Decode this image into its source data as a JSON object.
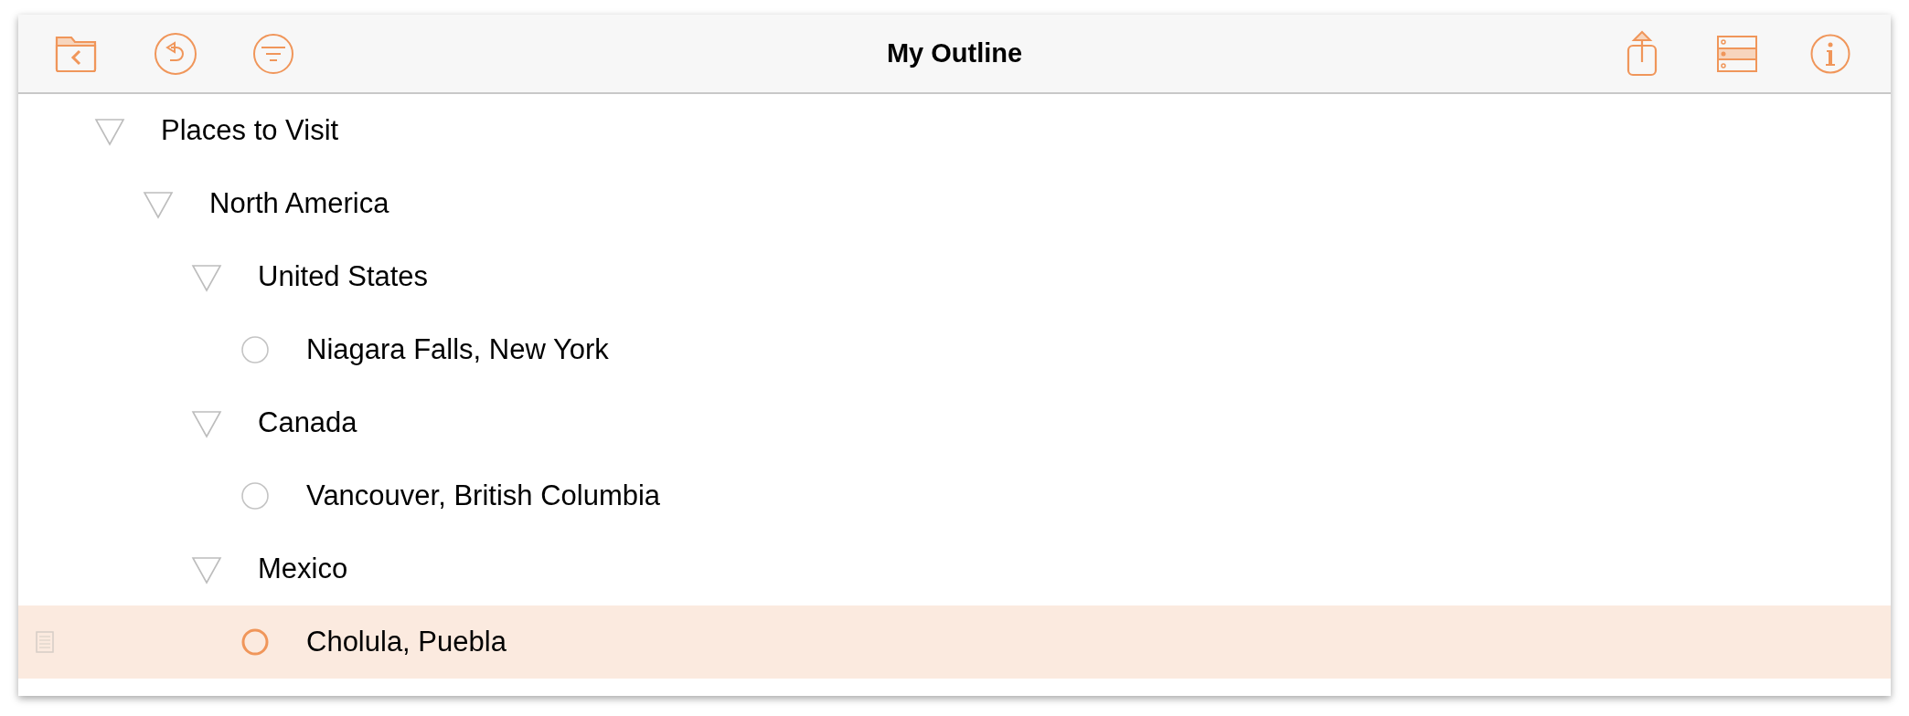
{
  "toolbar": {
    "title": "My Outline"
  },
  "outline": [
    {
      "kind": "parent",
      "text": "Places to Visit",
      "expanded": true,
      "selected": false,
      "children": [
        {
          "kind": "parent",
          "text": "North America",
          "expanded": true,
          "selected": false,
          "children": [
            {
              "kind": "parent",
              "text": "United States",
              "expanded": true,
              "selected": false,
              "children": [
                {
                  "kind": "leaf",
                  "text": "Niagara Falls, New York",
                  "selected": false
                }
              ]
            },
            {
              "kind": "parent",
              "text": "Canada",
              "expanded": true,
              "selected": false,
              "children": [
                {
                  "kind": "leaf",
                  "text": "Vancouver, British Columbia",
                  "selected": false
                }
              ]
            },
            {
              "kind": "parent",
              "text": "Mexico",
              "expanded": true,
              "selected": false,
              "children": [
                {
                  "kind": "leaf",
                  "text": "Cholula, Puebla",
                  "selected": true
                }
              ]
            }
          ]
        }
      ]
    }
  ]
}
